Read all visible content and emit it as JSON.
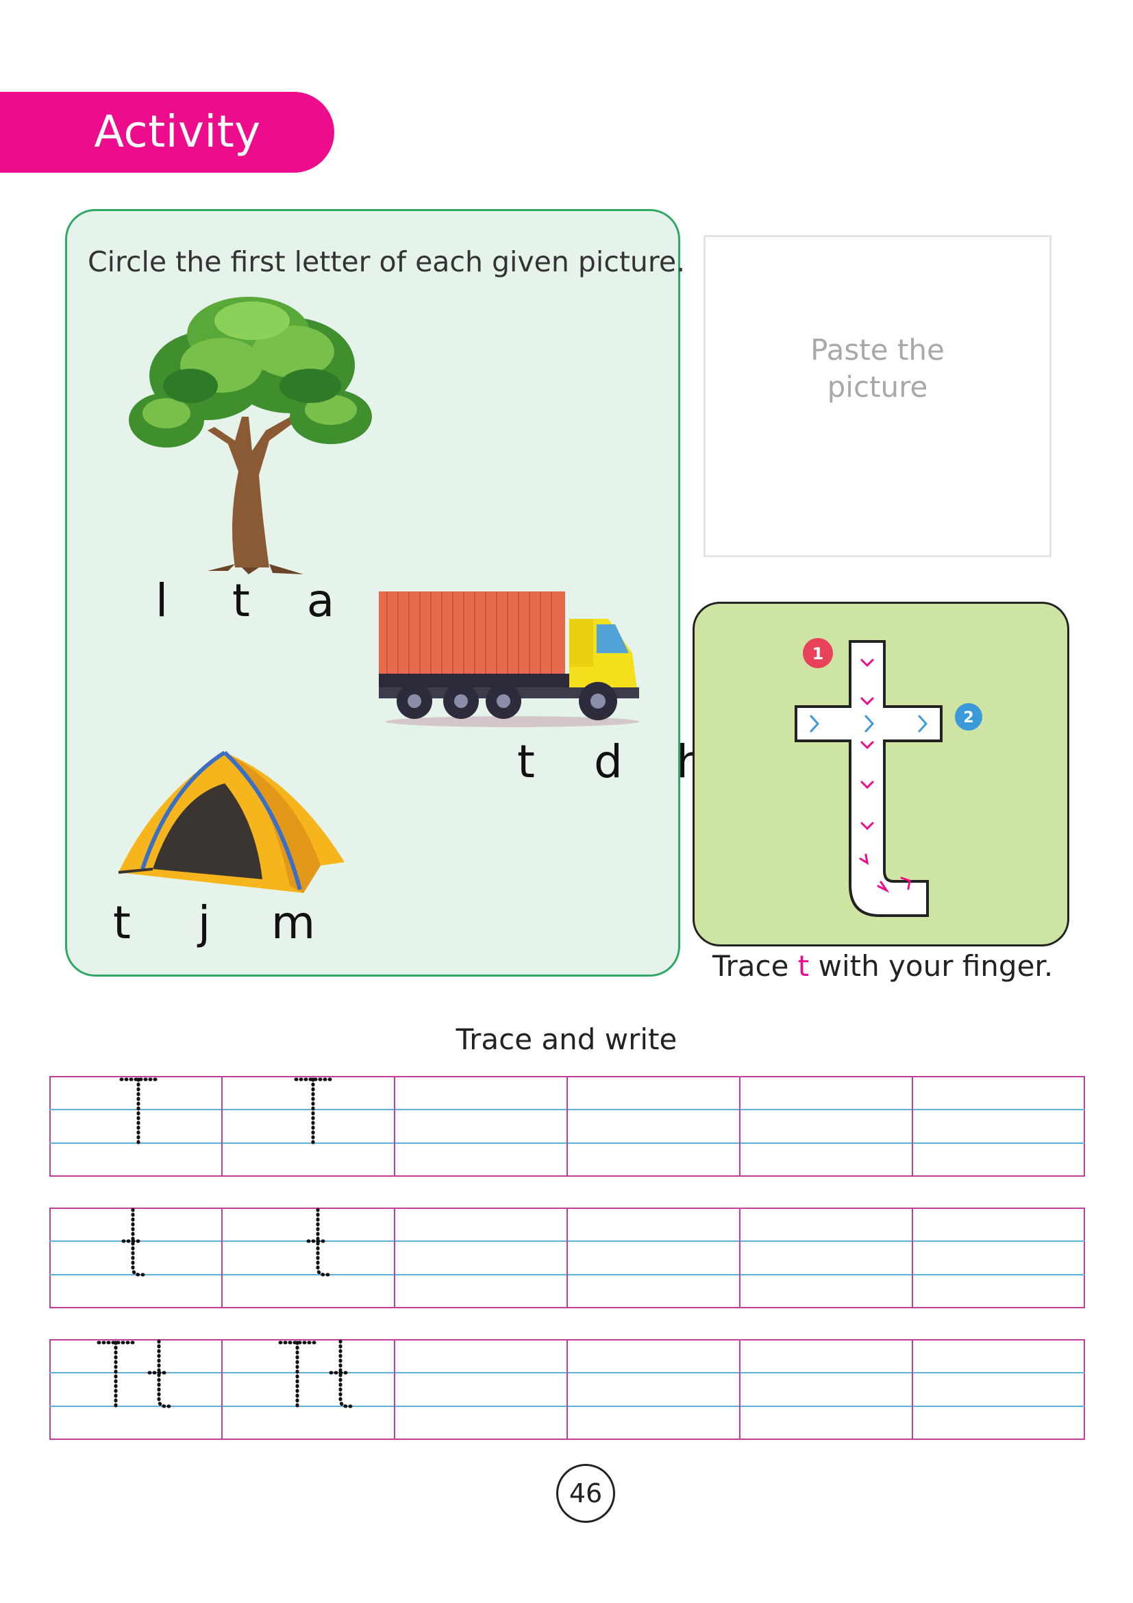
{
  "header": {
    "title": "Activity"
  },
  "circle_activity": {
    "instruction": "Circle the first letter of each given picture.",
    "items": [
      {
        "picture": "tree",
        "letters": [
          "l",
          "t",
          "a"
        ]
      },
      {
        "picture": "truck",
        "letters": [
          "t",
          "d",
          "h"
        ]
      },
      {
        "picture": "tent",
        "letters": [
          "t",
          "j",
          "m"
        ]
      }
    ]
  },
  "paste_box": {
    "label": "Paste the picture"
  },
  "finger_trace": {
    "caption_before": "Trace ",
    "caption_letter": "t",
    "caption_after": " with your finger.",
    "step_1": "1",
    "step_2": "2"
  },
  "writing_practice": {
    "title": "Trace and write",
    "rows": [
      {
        "guide": "T",
        "traced_cells": 2,
        "total_cells": 6
      },
      {
        "guide": "t",
        "traced_cells": 2,
        "total_cells": 6
      },
      {
        "guide": "Tt",
        "traced_cells": 2,
        "total_cells": 6
      }
    ]
  },
  "page_number": "46",
  "colors": {
    "accent_pink": "#ec0c8c",
    "panel_green_border": "#2fa866",
    "panel_green_fill": "#e6f3ea",
    "trace_panel_fill": "#cde4a2",
    "step_2_blue": "#3a9ad9"
  }
}
